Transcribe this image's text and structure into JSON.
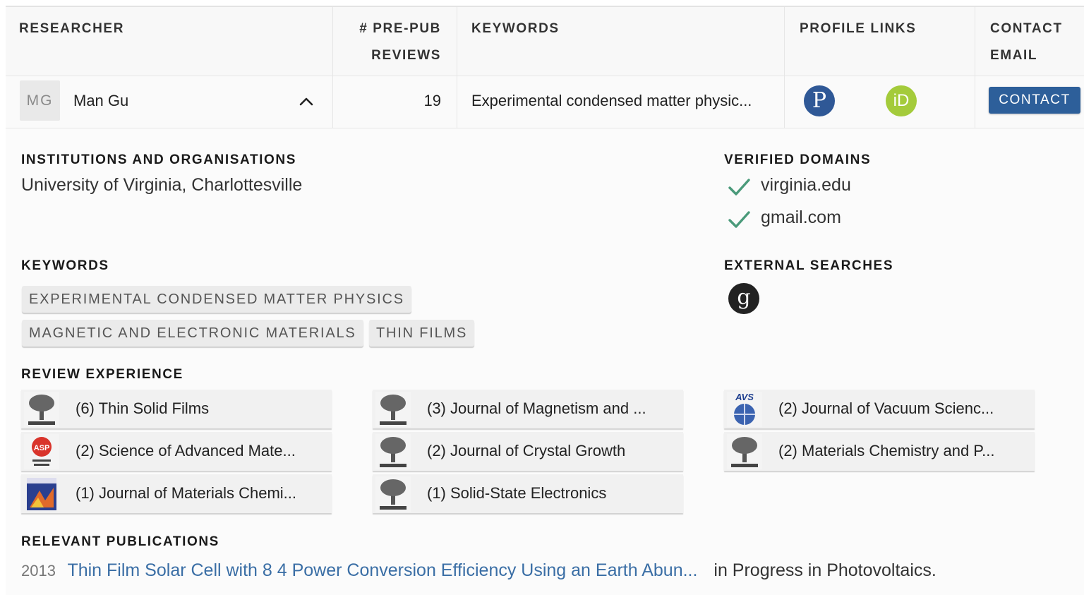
{
  "table": {
    "headers": {
      "researcher": "RESEARCHER",
      "reviews_line1": "# PRE-PUB",
      "reviews_line2": "REVIEWS",
      "keywords": "KEYWORDS",
      "profile_links": "PROFILE LINKS",
      "contact_line1": "CONTACT",
      "contact_line2": "EMAIL"
    },
    "row": {
      "initials": "MG",
      "name": "Man Gu",
      "reviews": "19",
      "keywords": "Experimental condensed matter physic...",
      "publons_glyph": "P",
      "orcid_glyph": "iD",
      "contact_label": "CONTACT"
    }
  },
  "detail": {
    "institutions_title": "INSTITUTIONS AND ORGANISATIONS",
    "institution": "University of Virginia, Charlottesville",
    "verified_title": "VERIFIED DOMAINS",
    "domains": [
      "virginia.edu",
      "gmail.com"
    ],
    "keywords_title": "KEYWORDS",
    "keyword_chips": [
      "EXPERIMENTAL CONDENSED MATTER PHYSICS",
      "MAGNETIC AND ELECTRONIC MATERIALS",
      "THIN FILMS"
    ],
    "external_title": "EXTERNAL SEARCHES",
    "scholar_glyph": "g",
    "review_title": "REVIEW EXPERIENCE",
    "journals": [
      "(6) Thin Solid Films",
      "(3) Journal of Magnetism and ...",
      "(2) Journal of Vacuum Scienc...",
      "(2) Science of Advanced Mate...",
      "(2) Journal of Crystal Growth",
      "(2) Materials Chemistry and P...",
      "(1) Journal of Materials Chemi...",
      "(1) Solid-State Electronics"
    ],
    "publications_title": "RELEVANT PUBLICATIONS",
    "publication": {
      "year": "2013",
      "title": "Thin Film Solar Cell with 8 4 Power Conversion Efficiency Using an Earth Abun...",
      "venue": "in Progress in Photovoltaics."
    }
  },
  "colors": {
    "contact_button": "#2d5f9a",
    "publons": "#2f5896",
    "orcid": "#a4cb3b",
    "check": "#4a9a7a",
    "link": "#3a6ea5"
  }
}
